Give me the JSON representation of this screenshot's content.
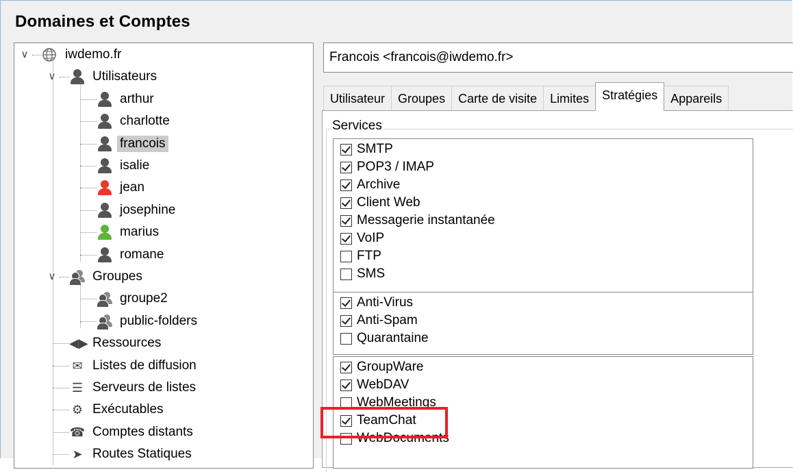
{
  "title": "Domaines et Comptes",
  "tree": {
    "domain": "iwdemo.fr",
    "users_folder": "Utilisateurs",
    "users": [
      {
        "label": "arthur",
        "color": "#555555"
      },
      {
        "label": "charlotte",
        "color": "#555555"
      },
      {
        "label": "francois",
        "color": "#555555"
      },
      {
        "label": "isalie",
        "color": "#555555"
      },
      {
        "label": "jean",
        "color": "#e8392a"
      },
      {
        "label": "josephine",
        "color": "#555555"
      },
      {
        "label": "marius",
        "color": "#5bb63b"
      },
      {
        "label": "romane",
        "color": "#555555"
      }
    ],
    "selected_user": "francois",
    "groups_folder": "Groupes",
    "groups": [
      "groupe2",
      "public-folders"
    ],
    "others": [
      {
        "label": "Ressources",
        "icon": "resources-icon"
      },
      {
        "label": "Listes de diffusion",
        "icon": "mailing-list-icon"
      },
      {
        "label": "Serveurs de listes",
        "icon": "list-server-icon"
      },
      {
        "label": "Exécutables",
        "icon": "gear-icon"
      },
      {
        "label": "Comptes distants",
        "icon": "remote-account-icon"
      },
      {
        "label": "Routes Statiques",
        "icon": "route-arrow-icon"
      }
    ]
  },
  "account": "Francois <francois@iwdemo.fr>",
  "tabs": [
    "Utilisateur",
    "Groupes",
    "Carte de visite",
    "Limites",
    "Stratégies",
    "Appareils"
  ],
  "active_tab": "Stratégies",
  "services_label": "Services",
  "lists": [
    [
      {
        "label": "SMTP",
        "checked": true
      },
      {
        "label": "POP3 / IMAP",
        "checked": true
      },
      {
        "label": "Archive",
        "checked": true
      },
      {
        "label": "Client Web",
        "checked": true
      },
      {
        "label": "Messagerie instantanée",
        "checked": true
      },
      {
        "label": "VoIP",
        "checked": true
      },
      {
        "label": "FTP",
        "checked": false
      },
      {
        "label": "SMS",
        "checked": false
      }
    ],
    [
      {
        "label": "Anti-Virus",
        "checked": true
      },
      {
        "label": "Anti-Spam",
        "checked": true
      },
      {
        "label": "Quarantaine",
        "checked": false
      }
    ],
    [
      {
        "label": "GroupWare",
        "checked": true
      },
      {
        "label": "WebDAV",
        "checked": true
      },
      {
        "label": "WebMeetings",
        "checked": false
      },
      {
        "label": "TeamChat",
        "checked": true
      },
      {
        "label": "WebDocuments",
        "checked": false
      }
    ]
  ],
  "highlight_color": "#e8202a"
}
